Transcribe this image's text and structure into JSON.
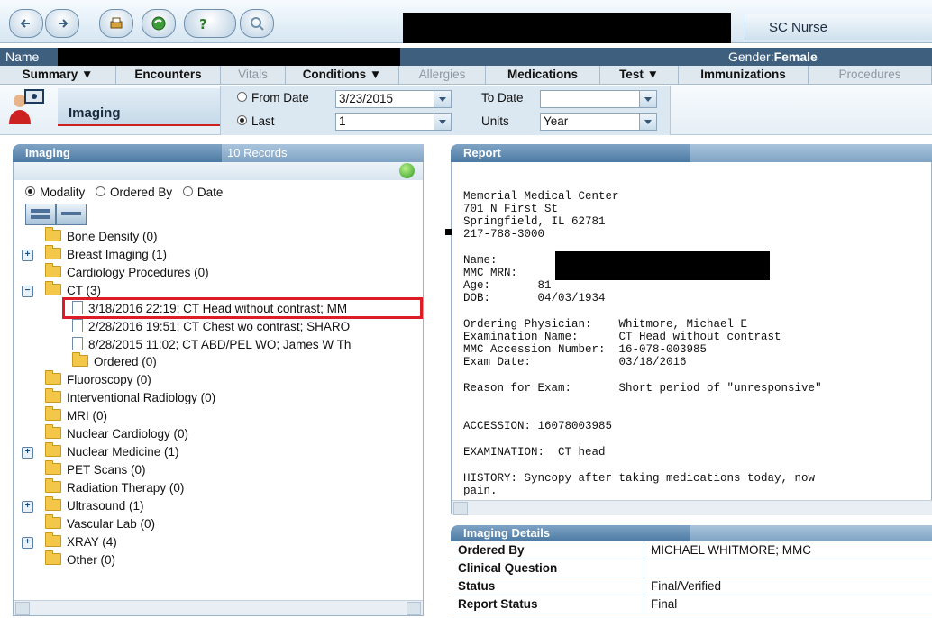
{
  "toolbar": {
    "buttons": [
      "back-icon",
      "forward-icon",
      "print-icon",
      "refresh-icon",
      "help-icon",
      "search-icon"
    ],
    "role": "SC Nurse"
  },
  "patient": {
    "name_label": "Name",
    "gender_label": "Gender:",
    "gender_value": "Female"
  },
  "tabs": [
    {
      "label": "Summary ▼",
      "disabled": false
    },
    {
      "label": "Encounters",
      "disabled": false
    },
    {
      "label": "Vitals",
      "disabled": true
    },
    {
      "label": "Conditions ▼",
      "disabled": false
    },
    {
      "label": "Allergies",
      "disabled": true
    },
    {
      "label": "Medications",
      "disabled": false
    },
    {
      "label": "Test ▼",
      "disabled": false
    },
    {
      "label": "Immunizations",
      "disabled": false
    },
    {
      "label": "Procedures",
      "disabled": true
    }
  ],
  "imaging_header": {
    "title": "Imaging",
    "from_date_label": "From Date",
    "from_date_value": "3/23/2015",
    "to_date_label": "To Date",
    "to_date_value": "",
    "last_label": "Last",
    "last_value": "1",
    "units_label": "Units",
    "units_value": "Year"
  },
  "left_panel": {
    "title": "Imaging",
    "records": "10 Records",
    "filters": {
      "modality": "Modality",
      "ordered_by": "Ordered By",
      "date": "Date"
    },
    "tree": {
      "bone_density": "Bone Density (0)",
      "breast_imaging": "Breast Imaging (1)",
      "cardiology": "Cardiology Procedures (0)",
      "ct": "CT (3)",
      "ct_item_1": "3/18/2016 22:19; CT Head without contrast; MM",
      "ct_item_2": "2/28/2016 19:51; CT Chest wo contrast; SHARO",
      "ct_item_3": "8/28/2015 11:02; CT ABD/PEL WO; James W Th",
      "ct_ordered": "Ordered (0)",
      "fluoroscopy": "Fluoroscopy (0)",
      "interventional": "Interventional Radiology (0)",
      "mri": "MRI (0)",
      "nuclear_cardiology": "Nuclear Cardiology (0)",
      "nuclear_medicine": "Nuclear Medicine (1)",
      "pet": "PET Scans (0)",
      "radiation": "Radiation Therapy (0)",
      "ultrasound": "Ultrasound (1)",
      "vascular": "Vascular Lab (0)",
      "xray": "XRAY (4)",
      "other": "Other (0)"
    }
  },
  "report": {
    "title": "Report",
    "line_facility": "Memorial Medical Center",
    "line_address1": "701 N First St",
    "line_address2": "Springfield, IL 62781",
    "line_phone": "217-788-3000",
    "name_label": "Name:",
    "mrn_label": "MMC MRN:",
    "age_line": "Age:       81",
    "dob_line": "DOB:       04/03/1934",
    "ordering_line": "Ordering Physician:    Whitmore, Michael E",
    "exam_name_line": "Examination Name:      CT Head without contrast",
    "accession_line": "MMC Accession Number:  16-078-003985",
    "exam_date_line": "Exam Date:             03/18/2016",
    "reason_line": "Reason for Exam:       Short period of \"unresponsive\"",
    "accession2_line": "ACCESSION: 16078003985",
    "examination_line": "EXAMINATION:  CT head",
    "history_line1": "HISTORY: Syncopy after taking medications today, now",
    "history_line2": "pain."
  },
  "details": {
    "title": "Imaging Details",
    "rows": [
      {
        "k": "Ordered By",
        "v": "MICHAEL WHITMORE; MMC"
      },
      {
        "k": "Clinical Question",
        "v": ""
      },
      {
        "k": "Status",
        "v": "Final/Verified"
      },
      {
        "k": "Report Status",
        "v": "Final"
      }
    ]
  },
  "colors": {
    "highlight": "#dd1c25",
    "header_blue": "#4c7aa4",
    "patient_bar": "#3f5f7f"
  }
}
